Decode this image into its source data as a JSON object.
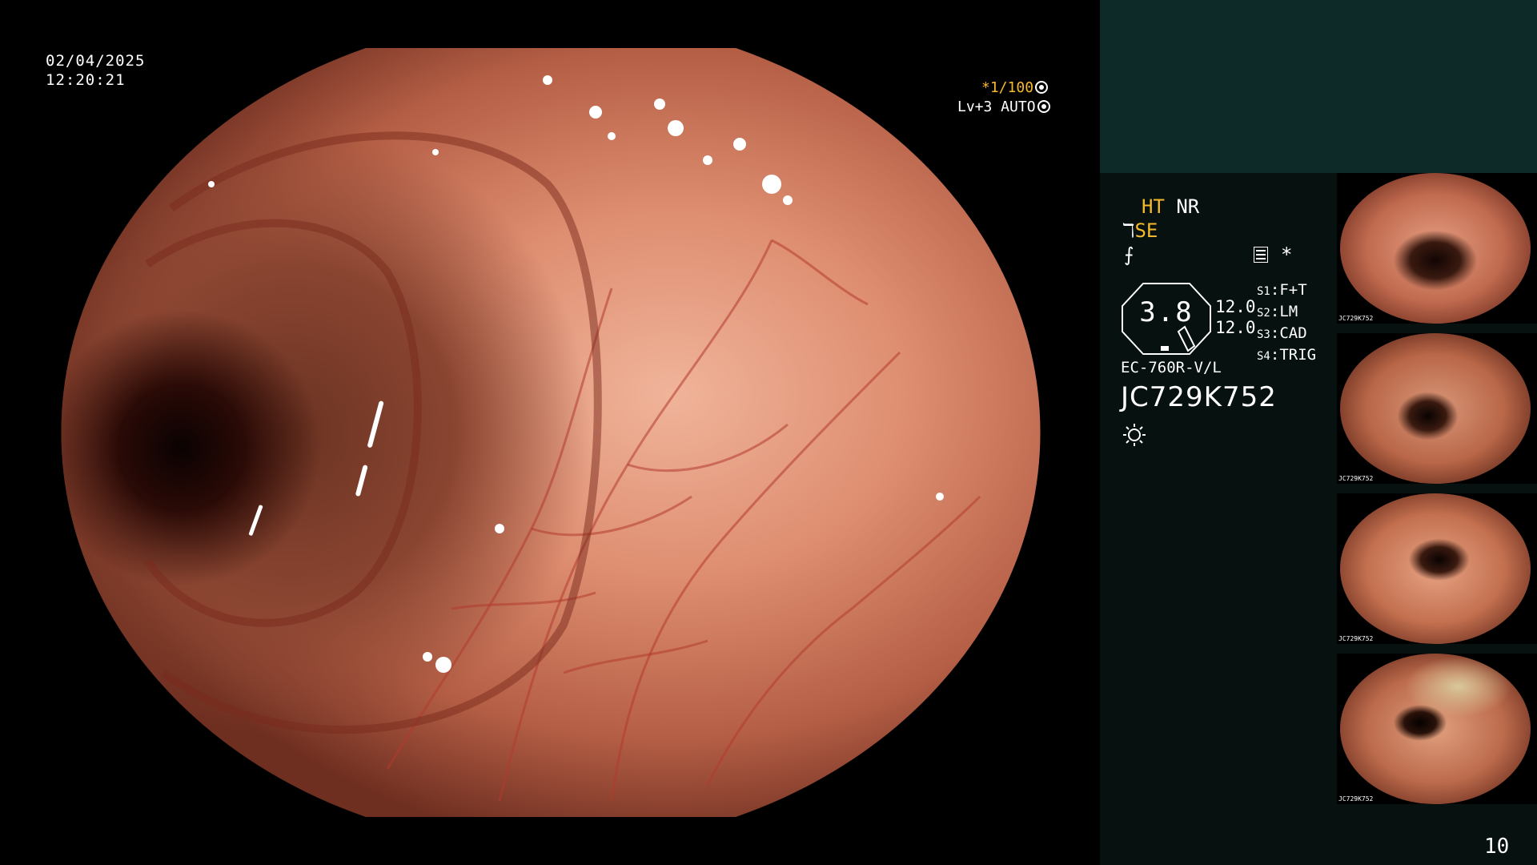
{
  "overlay": {
    "date": "02/04/2025",
    "time": "12:20:21",
    "shutter_star": "*",
    "shutter": "1/100",
    "level": "Lv+3 AUTO"
  },
  "panel": {
    "ht": "HT",
    "nr": "NR",
    "se_prefix": "ℸ",
    "se": "SE",
    "f_icon": "⨍",
    "star": "*",
    "zoom_value": "3.8",
    "value1": "12.0",
    "value2": "12.0",
    "slots": [
      {
        "key": "S1",
        "label": "F+T"
      },
      {
        "key": "S2",
        "label": "LM"
      },
      {
        "key": "S3",
        "label": "CAD"
      },
      {
        "key": "S4",
        "label": "TRIG"
      }
    ],
    "scope_model": "EC-760R-V/L",
    "serial": "JC729K752",
    "icons": {
      "menu": "menu-list-icon",
      "brightness": "sun-icon"
    }
  },
  "thumbnails": [
    {
      "caption": "JC729K752"
    },
    {
      "caption": "JC729K752"
    },
    {
      "caption": "JC729K752"
    },
    {
      "caption": "JC729K752"
    }
  ],
  "page_number": "10",
  "colors": {
    "accent": "#f6b92a",
    "panel_bg": "#061110",
    "panel_top": "#0e2a28"
  }
}
